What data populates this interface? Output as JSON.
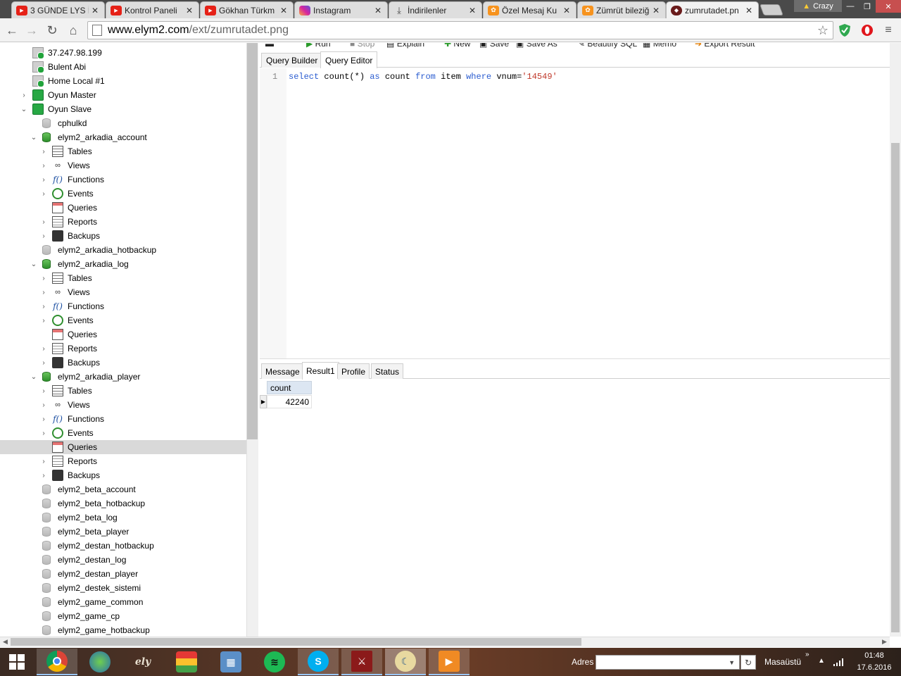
{
  "browser": {
    "tabs": [
      {
        "title": "3 GÜNDE LYS İ",
        "favicon": "youtube-icon"
      },
      {
        "title": "Kontrol Paneli",
        "favicon": "youtube-icon"
      },
      {
        "title": "Gökhan Türkm",
        "favicon": "youtube-icon"
      },
      {
        "title": "Instagram",
        "favicon": "instagram-icon"
      },
      {
        "title": "İndirilenler",
        "favicon": "download-icon"
      },
      {
        "title": "Özel Mesaj Ku",
        "favicon": "forum-icon"
      },
      {
        "title": "Zümrüt bileziğ",
        "favicon": "forum-icon"
      },
      {
        "title": "zumrutadet.pn",
        "favicon": "elym-icon",
        "active": true
      }
    ],
    "profile_name": "Crazy",
    "url_host": "www.elym2.com",
    "url_path": "/ext/zumrutadet.png"
  },
  "tree": {
    "nodes": [
      {
        "label": "37.247.98.199",
        "level": 0,
        "icon": "connection-icon",
        "arrow": ""
      },
      {
        "label": "Bulent Abi",
        "level": 0,
        "icon": "connection-icon",
        "arrow": ""
      },
      {
        "label": "Home Local #1",
        "level": 0,
        "icon": "connection-icon",
        "arrow": ""
      },
      {
        "label": "Oyun Master",
        "level": 0,
        "icon": "server-green-icon",
        "arrow": "collapsed"
      },
      {
        "label": "Oyun Slave",
        "level": 0,
        "icon": "server-green-icon",
        "arrow": "expanded"
      },
      {
        "label": "cphulkd",
        "level": 1,
        "icon": "database-gray-icon",
        "arrow": ""
      },
      {
        "label": "elym2_arkadia_account",
        "level": 1,
        "icon": "database-green-icon",
        "arrow": "expanded"
      },
      {
        "label": "Tables",
        "level": 2,
        "icon": "table-icon",
        "arrow": "collapsed"
      },
      {
        "label": "Views",
        "level": 2,
        "icon": "view-icon",
        "arrow": "collapsed"
      },
      {
        "label": "Functions",
        "level": 2,
        "icon": "function-icon",
        "arrow": "collapsed"
      },
      {
        "label": "Events",
        "level": 2,
        "icon": "event-icon",
        "arrow": "collapsed"
      },
      {
        "label": "Queries",
        "level": 2,
        "icon": "query-icon",
        "arrow": ""
      },
      {
        "label": "Reports",
        "level": 2,
        "icon": "report-icon",
        "arrow": "collapsed"
      },
      {
        "label": "Backups",
        "level": 2,
        "icon": "backup-icon",
        "arrow": "collapsed"
      },
      {
        "label": "elym2_arkadia_hotbackup",
        "level": 1,
        "icon": "database-gray-icon",
        "arrow": ""
      },
      {
        "label": "elym2_arkadia_log",
        "level": 1,
        "icon": "database-green-icon",
        "arrow": "expanded"
      },
      {
        "label": "Tables",
        "level": 2,
        "icon": "table-icon",
        "arrow": "collapsed"
      },
      {
        "label": "Views",
        "level": 2,
        "icon": "view-icon",
        "arrow": "collapsed"
      },
      {
        "label": "Functions",
        "level": 2,
        "icon": "function-icon",
        "arrow": "collapsed"
      },
      {
        "label": "Events",
        "level": 2,
        "icon": "event-icon",
        "arrow": "collapsed"
      },
      {
        "label": "Queries",
        "level": 2,
        "icon": "query-icon",
        "arrow": ""
      },
      {
        "label": "Reports",
        "level": 2,
        "icon": "report-icon",
        "arrow": "collapsed"
      },
      {
        "label": "Backups",
        "level": 2,
        "icon": "backup-icon",
        "arrow": "collapsed"
      },
      {
        "label": "elym2_arkadia_player",
        "level": 1,
        "icon": "database-green-icon",
        "arrow": "expanded"
      },
      {
        "label": "Tables",
        "level": 2,
        "icon": "table-icon",
        "arrow": "collapsed"
      },
      {
        "label": "Views",
        "level": 2,
        "icon": "view-icon",
        "arrow": "collapsed"
      },
      {
        "label": "Functions",
        "level": 2,
        "icon": "function-icon",
        "arrow": "collapsed"
      },
      {
        "label": "Events",
        "level": 2,
        "icon": "event-icon",
        "arrow": "collapsed"
      },
      {
        "label": "Queries",
        "level": 2,
        "icon": "query-icon",
        "arrow": "",
        "selected": true
      },
      {
        "label": "Reports",
        "level": 2,
        "icon": "report-icon",
        "arrow": "collapsed"
      },
      {
        "label": "Backups",
        "level": 2,
        "icon": "backup-icon",
        "arrow": "collapsed"
      },
      {
        "label": "elym2_beta_account",
        "level": 1,
        "icon": "database-gray-icon",
        "arrow": ""
      },
      {
        "label": "elym2_beta_hotbackup",
        "level": 1,
        "icon": "database-gray-icon",
        "arrow": ""
      },
      {
        "label": "elym2_beta_log",
        "level": 1,
        "icon": "database-gray-icon",
        "arrow": ""
      },
      {
        "label": "elym2_beta_player",
        "level": 1,
        "icon": "database-gray-icon",
        "arrow": ""
      },
      {
        "label": "elym2_destan_hotbackup",
        "level": 1,
        "icon": "database-gray-icon",
        "arrow": ""
      },
      {
        "label": "elym2_destan_log",
        "level": 1,
        "icon": "database-gray-icon",
        "arrow": ""
      },
      {
        "label": "elym2_destan_player",
        "level": 1,
        "icon": "database-gray-icon",
        "arrow": ""
      },
      {
        "label": "elym2_destek_sistemi",
        "level": 1,
        "icon": "database-gray-icon",
        "arrow": ""
      },
      {
        "label": "elym2_game_common",
        "level": 1,
        "icon": "database-gray-icon",
        "arrow": ""
      },
      {
        "label": "elym2_game_cp",
        "level": 1,
        "icon": "database-gray-icon",
        "arrow": ""
      },
      {
        "label": "elym2_game_hotbackup",
        "level": 1,
        "icon": "database-gray-icon",
        "arrow": ""
      }
    ]
  },
  "query_toolbar": {
    "run": "Run",
    "stop": "Stop",
    "explain": "Explain",
    "new": "New",
    "save": "Save",
    "save_as": "Save As",
    "beautify": "Beautify SQL",
    "memo": "Memo",
    "export": "Export Result"
  },
  "editor_tabs": [
    "Query Builder",
    "Query Editor"
  ],
  "active_editor_tab": "Query Editor",
  "editor": {
    "line_number": "1",
    "tokens": {
      "select": "select",
      "count_fn": "count(*)",
      "as": "as",
      "alias": "count",
      "from": "from",
      "table": "item",
      "where": "where",
      "cond": "vnum=",
      "value": "'14549'"
    }
  },
  "result_tabs": [
    "Message",
    "Result1",
    "Profile",
    "Status"
  ],
  "active_result_tab": "Result1",
  "result": {
    "column": "count",
    "value": "42240"
  },
  "taskbar": {
    "address_label": "Adres",
    "address_value": "",
    "desktop_label": "Masaüstü",
    "time": "01:48",
    "date": "17.6.2016"
  },
  "colors": {
    "sql_keyword": "#2a5cd0",
    "sql_string": "#c0392b",
    "grid_header": "#dce6f2",
    "tree_selection": "#d9d9d9"
  }
}
